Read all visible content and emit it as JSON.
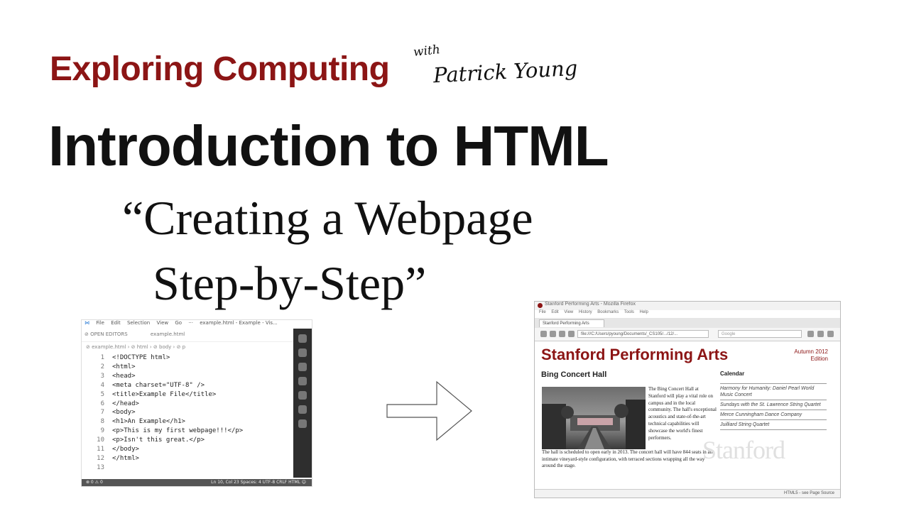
{
  "header": {
    "series_title": "Exploring Computing",
    "with": "with",
    "author": "Patrick Young",
    "main_title": "Introduction to HTML",
    "subtitle_line1": "“Creating a Webpage",
    "subtitle_line2": "Step-by-Step”"
  },
  "colors": {
    "brand": "#8c1515",
    "text": "#111111",
    "editor_sidebar": "#2e2e2e",
    "editor_status": "#555555"
  },
  "editor": {
    "menu": [
      "File",
      "Edit",
      "Selection",
      "View",
      "Go",
      "···",
      "example.html - Example - Vis..."
    ],
    "tab_left": "⊘ OPEN EDITORS",
    "tab_active": "example.html",
    "breadcrumb": "⊘ example.html › ⊘ html › ⊘ body › ⊘ p",
    "lines": [
      {
        "n": "1",
        "code": "<!DOCTYPE html>"
      },
      {
        "n": "2",
        "code": "<html>"
      },
      {
        "n": "3",
        "code": "<head>"
      },
      {
        "n": "4",
        "code": "<meta charset=\"UTF-8\" />"
      },
      {
        "n": "5",
        "code": "<title>Example File</title>"
      },
      {
        "n": "6",
        "code": "</head>"
      },
      {
        "n": "7",
        "code": "<body>"
      },
      {
        "n": "8",
        "code": "<h1>An Example</h1>"
      },
      {
        "n": "9",
        "code": "<p>This is my first webpage!!!</p>"
      },
      {
        "n": "10",
        "code": "<p>Isn't this great.</p>"
      },
      {
        "n": "11",
        "code": "</body>"
      },
      {
        "n": "12",
        "code": "</html>"
      },
      {
        "n": "13",
        "code": ""
      }
    ],
    "status_left": "⊗ 0 ⚠ 0",
    "status_right": "Ln 10, Col 23   Spaces: 4   UTF-8   CRLF   HTML   ☺"
  },
  "browser": {
    "window_title": "Stanford Performing Arts - Mozilla Firefox",
    "menu": [
      "File",
      "Edit",
      "View",
      "History",
      "Bookmarks",
      "Tools",
      "Help"
    ],
    "tab_title": "Stanford Performing Arts",
    "url": "file:///C:/Users/pyoung/Documents/_CS105/.../12/...",
    "search_placeholder": "Google",
    "site_title": "Stanford Performing Arts",
    "edition_line1": "Autumn 2012",
    "edition_line2": "Edition",
    "section_title": "Bing Concert Hall",
    "hall_text": "The Bing Concert Hall at Stanford will play a vital role on campus and in the local community. The hall's exceptional acoustics and state-of-the-art technical capabilities will showcase the world's finest performers.",
    "hall_text_2": "The hall is scheduled to open early in 2013. The concert hall will have 844 seats in an intimate vineyard-style configuration, with terraced sections wrapping all the way around the stage.",
    "calendar_title": "Calendar",
    "calendar_items": [
      "Harmony for Humanity: Daniel Pearl World Music Concert",
      "Sundays with the St. Lawrence String Quartet",
      "Merce Cunningham Dance Company",
      "Juilliard String Quartet"
    ],
    "watermark": "Stanford",
    "status": "HTML5 - see Page Source"
  }
}
